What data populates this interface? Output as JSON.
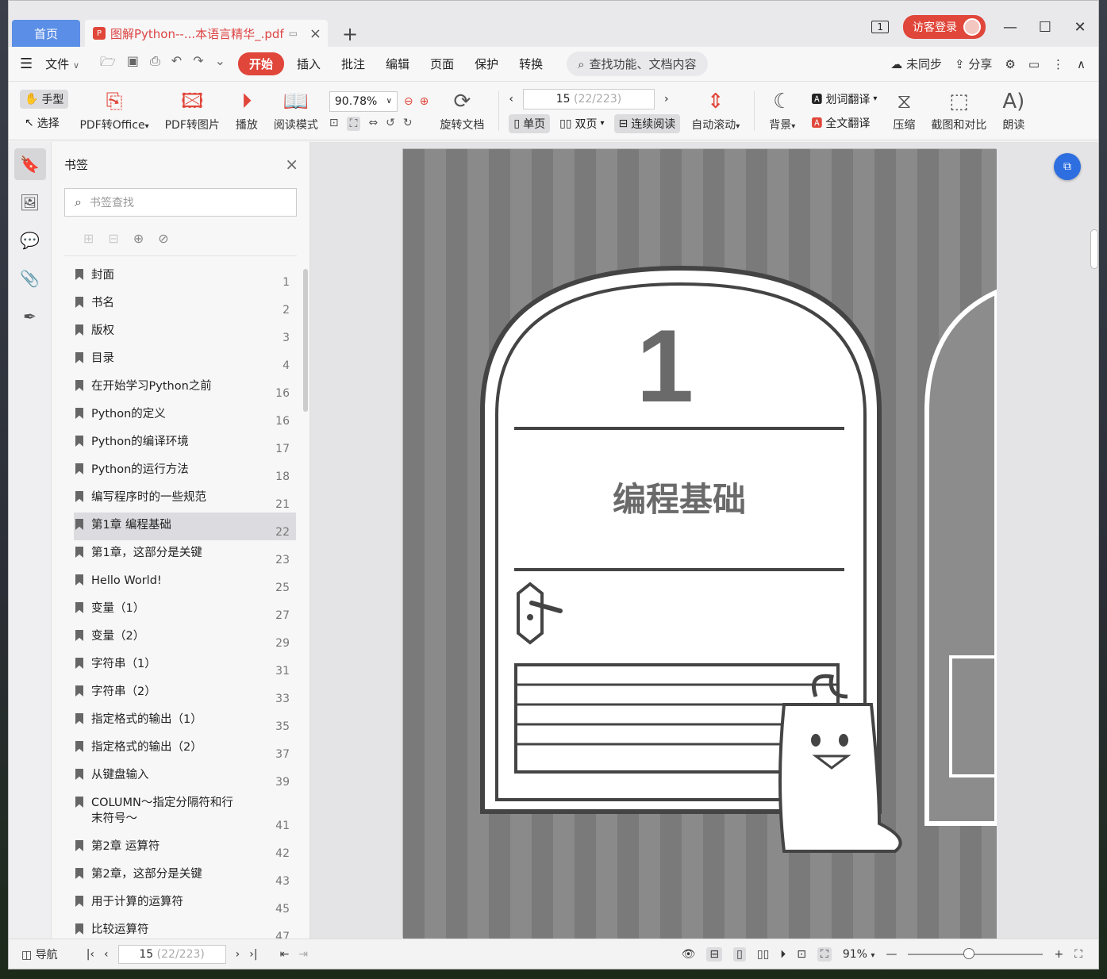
{
  "titlebar": {
    "home_tab": "首页",
    "doc_tab": "图解Python--...本语言精华_.pdf",
    "login": "访客登录",
    "win_badge": "1"
  },
  "menu": {
    "file": "文件",
    "items": [
      "开始",
      "插入",
      "批注",
      "编辑",
      "页面",
      "保护",
      "转换"
    ],
    "search": "查找功能、文档内容",
    "sync": "未同步",
    "share": "分享"
  },
  "ribbon": {
    "hand": "手型",
    "select": "选择",
    "pdf_office": "PDF转Office",
    "pdf_image": "PDF转图片",
    "play": "播放",
    "read_mode": "阅读模式",
    "zoom": "90.78%",
    "rotate": "旋转文档",
    "page_current": "15",
    "page_total": "(22/223)",
    "single": "单页",
    "double": "双页",
    "continuous": "连续阅读",
    "autoscroll": "自动滚动",
    "background": "背景",
    "word_translate": "划词翻译",
    "full_translate": "全文翻译",
    "compress": "压缩",
    "screenshot": "截图和对比",
    "read_aloud": "朗读"
  },
  "panel": {
    "title": "书签",
    "search_placeholder": "书签查找",
    "bookmarks": [
      {
        "title": "封面",
        "page": "1"
      },
      {
        "title": "书名",
        "page": "2"
      },
      {
        "title": "版权",
        "page": "3"
      },
      {
        "title": "目录",
        "page": "4"
      },
      {
        "title": "在开始学习Python之前",
        "page": "16"
      },
      {
        "title": "Python的定义",
        "page": "16"
      },
      {
        "title": "Python的编译环境",
        "page": "17"
      },
      {
        "title": "Python的运行方法",
        "page": "18"
      },
      {
        "title": "编写程序时的一些规范",
        "page": "21"
      },
      {
        "title": "第1章  编程基础",
        "page": "22"
      },
      {
        "title": "第1章，这部分是关键",
        "page": "23"
      },
      {
        "title": "Hello World!",
        "page": "25"
      },
      {
        "title": "变量（1）",
        "page": "27"
      },
      {
        "title": "变量（2）",
        "page": "29"
      },
      {
        "title": "字符串（1）",
        "page": "31"
      },
      {
        "title": "字符串（2）",
        "page": "33"
      },
      {
        "title": "指定格式的输出（1）",
        "page": "35"
      },
      {
        "title": "指定格式的输出（2）",
        "page": "37"
      },
      {
        "title": "从键盘输入",
        "page": "39"
      },
      {
        "title": "COLUMN～指定分隔符和行末符号～",
        "page": "41"
      },
      {
        "title": "第2章  运算符",
        "page": "42"
      },
      {
        "title": "第2章，这部分是关键",
        "page": "43"
      },
      {
        "title": "用于计算的运算符",
        "page": "45"
      },
      {
        "title": "比较运算符",
        "page": "47"
      }
    ]
  },
  "page": {
    "chapter_number": "1",
    "chapter_title": "编程基础"
  },
  "status": {
    "nav": "导航",
    "page_current": "15",
    "page_total": "(22/223)",
    "zoom": "91%"
  }
}
